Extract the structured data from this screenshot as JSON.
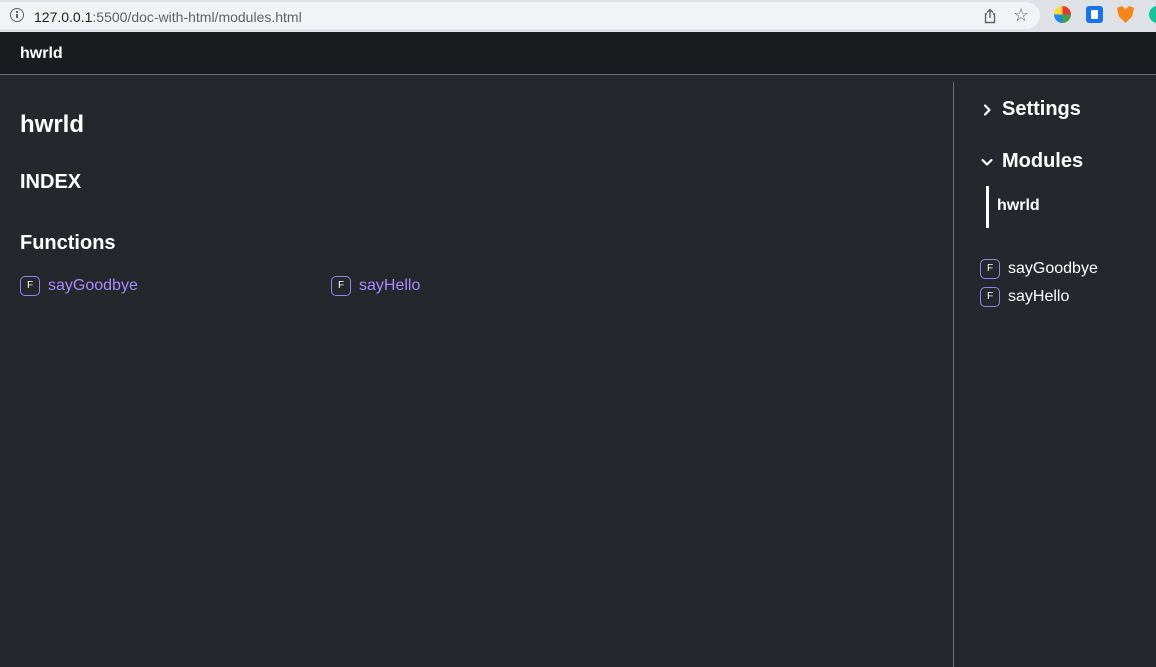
{
  "browser": {
    "url_host": "127.0.0.1",
    "url_rest": ":5500/doc-with-html/modules.html"
  },
  "header": {
    "site_title": "hwrld"
  },
  "main": {
    "title": "hwrld",
    "index_heading": "INDEX",
    "functions_heading": "Functions",
    "functions": [
      {
        "badge": "F",
        "name": "sayGoodbye"
      },
      {
        "badge": "F",
        "name": "sayHello"
      }
    ]
  },
  "sidebar": {
    "settings_label": "Settings",
    "settings_expanded": false,
    "modules_label": "Modules",
    "modules_expanded": true,
    "modules": [
      {
        "label": "hwrld"
      }
    ],
    "functions": [
      {
        "badge": "F",
        "name": "sayGoodbye"
      },
      {
        "badge": "F",
        "name": "sayHello"
      }
    ]
  },
  "colors": {
    "background": "#25272d",
    "nav_background": "#1a1b1e",
    "link": "#a58bff",
    "badge_border": "#9a7ff0"
  }
}
